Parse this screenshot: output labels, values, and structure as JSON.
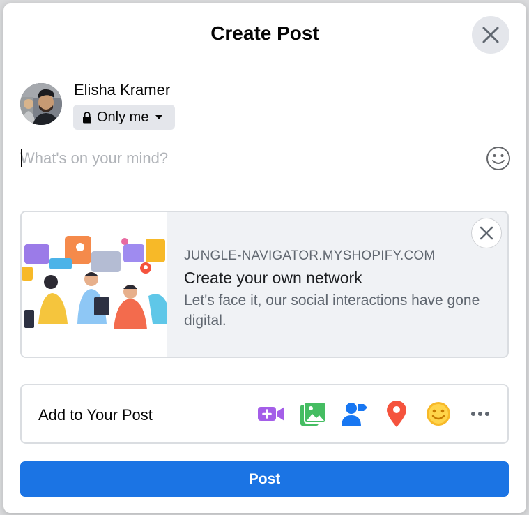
{
  "dialog": {
    "title": "Create Post",
    "close_icon": "close-icon"
  },
  "user": {
    "name": "Elisha Kramer",
    "avatar_icon": "profile-photo",
    "privacy": {
      "icon": "lock-icon",
      "label": "Only me",
      "dropdown_icon": "caret-down-icon"
    }
  },
  "composer": {
    "placeholder": "What's on your mind?",
    "value": "",
    "emoji_icon": "smiley-icon"
  },
  "link_preview": {
    "domain": "JUNGLE-NAVIGATOR.MYSHOPIFY.COM",
    "title": "Create your own network",
    "description": "Let's face it, our social interactions have gone digital.",
    "thumbnail_icon": "people-with-chat-bubbles-illustration",
    "close_icon": "close-icon"
  },
  "add_to_post": {
    "label": "Add to Your Post",
    "options": [
      {
        "name": "live-video",
        "icon": "video-camera-plus-icon",
        "color": "#a45ee8"
      },
      {
        "name": "photo-video",
        "icon": "photo-gallery-icon",
        "color": "#45bd62"
      },
      {
        "name": "tag-people",
        "icon": "tag-person-icon",
        "color": "#1877f2"
      },
      {
        "name": "check-in",
        "icon": "location-pin-icon",
        "color": "#f5533d"
      },
      {
        "name": "feeling-activity",
        "icon": "smiley-icon",
        "color": "#f7b928"
      },
      {
        "name": "more",
        "icon": "more-dots-icon",
        "color": "#606770"
      }
    ]
  },
  "post_button": {
    "label": "Post",
    "color": "#1b74e4"
  }
}
